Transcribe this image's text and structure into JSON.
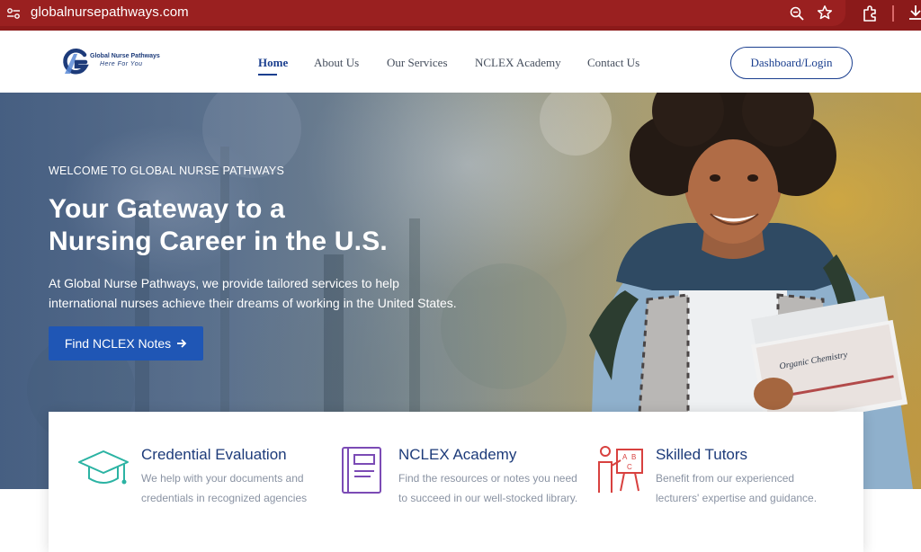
{
  "browser": {
    "url": "globalnursepathways.com",
    "icons": [
      "site-settings-icon",
      "zoom-icon",
      "star-icon",
      "extensions-icon",
      "download-icon"
    ]
  },
  "header": {
    "logo": {
      "name": "Global Nurse Pathways",
      "tagline": "Here For You"
    },
    "nav": [
      {
        "label": "Home",
        "active": true
      },
      {
        "label": "About Us"
      },
      {
        "label": "Our Services"
      },
      {
        "label": "NCLEX Academy"
      },
      {
        "label": "Contact Us"
      }
    ],
    "dashboard_label": "Dashboard/Login"
  },
  "hero": {
    "eyebrow": "WELCOME TO GLOBAL NURSE PATHWAYS",
    "title_line1": "Your Gateway to a",
    "title_line2": "Nursing Career in the U.S.",
    "description": "At Global Nurse Pathways, we provide tailored services to help international nurses achieve their dreams of working in the United States.",
    "cta_label": "Find NCLEX Notes",
    "book_label": "Organic Chemistry"
  },
  "features": [
    {
      "icon": "graduation-cap-icon",
      "title": "Credential Evaluation",
      "description": "We help with your documents and credentials in recognized agencies"
    },
    {
      "icon": "book-icon",
      "title": "NCLEX Academy",
      "description": "Find the resources or notes you need to succeed in our well-stocked library."
    },
    {
      "icon": "teacher-board-icon",
      "title": "Skilled Tutors",
      "description": "Benefit from our experienced lecturers' expertise and guidance."
    }
  ],
  "colors": {
    "browser_bar": "#8b1a1a",
    "brand_blue": "#1d3b7a",
    "cta_blue": "#1f56b5",
    "teal_icon": "#2bb3a3",
    "purple_icon": "#7b4bb5",
    "red_icon": "#d8413f"
  }
}
